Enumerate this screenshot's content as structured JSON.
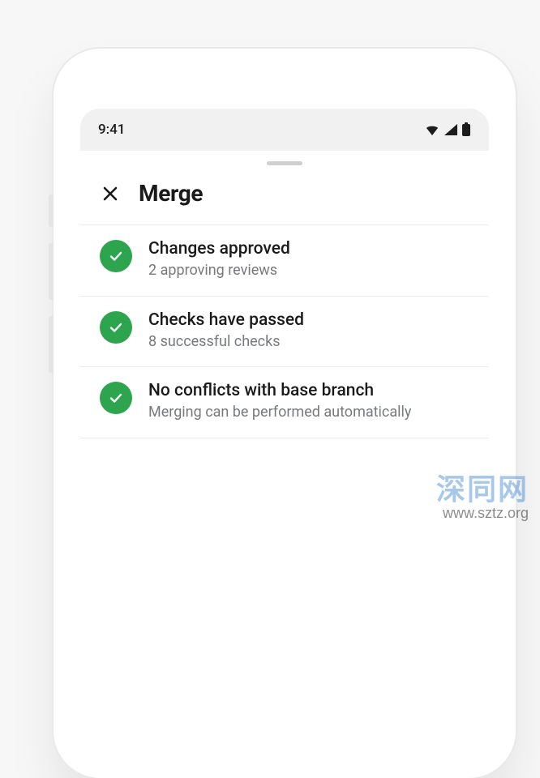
{
  "status": {
    "time": "9:41"
  },
  "sheet": {
    "title": "Merge"
  },
  "items": [
    {
      "title": "Changes approved",
      "subtitle": "2 approving reviews"
    },
    {
      "title": "Checks have passed",
      "subtitle": "8 successful checks"
    },
    {
      "title": "No conflicts with base branch",
      "subtitle": "Merging can be performed automatically"
    }
  ],
  "watermark": {
    "text": "深同网",
    "url": "www.sztz.org"
  },
  "colors": {
    "success": "#2da44e"
  }
}
